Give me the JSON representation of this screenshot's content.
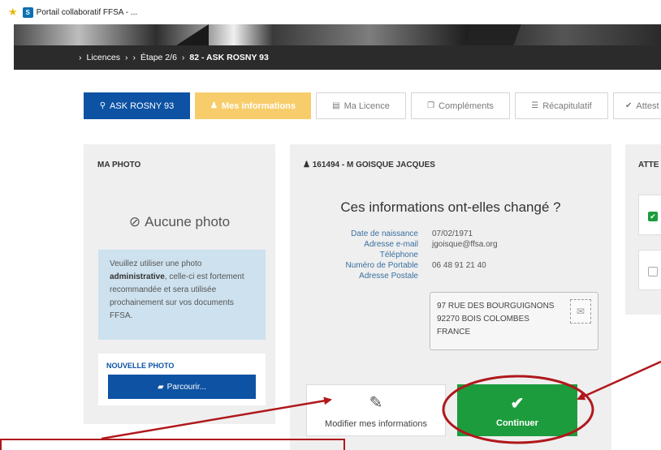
{
  "browser": {
    "tab_title": "Portail collaboratif FFSA - ...",
    "fav_icon": "star-icon",
    "site_icon": "sharepoint-icon"
  },
  "breadcrumb": {
    "items": [
      "›",
      "Licences",
      "›",
      "›",
      "Étape 2/6",
      "›"
    ],
    "current": "82 - ASK ROSNY 93"
  },
  "tabs": [
    {
      "label": "ASK ROSNY 93",
      "icon": "map-marker-icon"
    },
    {
      "label": "Mes informations",
      "icon": "user-icon"
    },
    {
      "label": "Ma Licence",
      "icon": "id-card-icon"
    },
    {
      "label": "Compléments",
      "icon": "copy-icon"
    },
    {
      "label": "Récapitulatif",
      "icon": "list-icon"
    },
    {
      "label": "Attest",
      "icon": "check-circle-icon"
    }
  ],
  "photo_panel": {
    "title": "MA PHOTO",
    "no_photo": "Aucune photo",
    "info_pre": "Veuillez utiliser une photo ",
    "info_bold": "administrative",
    "info_post": ", celle-ci est fortement recommandée et sera utilisée prochainement sur vos documents FFSA.",
    "new_photo_label": "NOUVELLE PHOTO",
    "browse_label": "Parcourir..."
  },
  "main_panel": {
    "person": "161494 - M GOISQUE JACQUES",
    "question": "Ces informations ont-elles changé ?",
    "fields": [
      {
        "label": "Date de naissance",
        "value": "07/02/1971"
      },
      {
        "label": "Adresse e-mail",
        "value": "jgoisque@ffsa.org"
      },
      {
        "label": "Téléphone",
        "value": ""
      },
      {
        "label": "Numéro de Portable",
        "value": "06 48 91 21 40"
      },
      {
        "label": "Adresse Postale",
        "value": ""
      }
    ],
    "address_lines": [
      "97 RUE DES BOURGUIGNONS",
      "92270 BOIS COLOMBES",
      "FRANCE"
    ],
    "modify_label": "Modifier mes informations",
    "continue_label": "Continuer"
  },
  "attest_panel": {
    "title": "ATTE"
  },
  "colors": {
    "primary": "#0d52a3",
    "active_tab": "#f7cd6b",
    "success": "#1d9c3d",
    "annotation": "#b0181c",
    "info_bg": "#cde1ee"
  }
}
